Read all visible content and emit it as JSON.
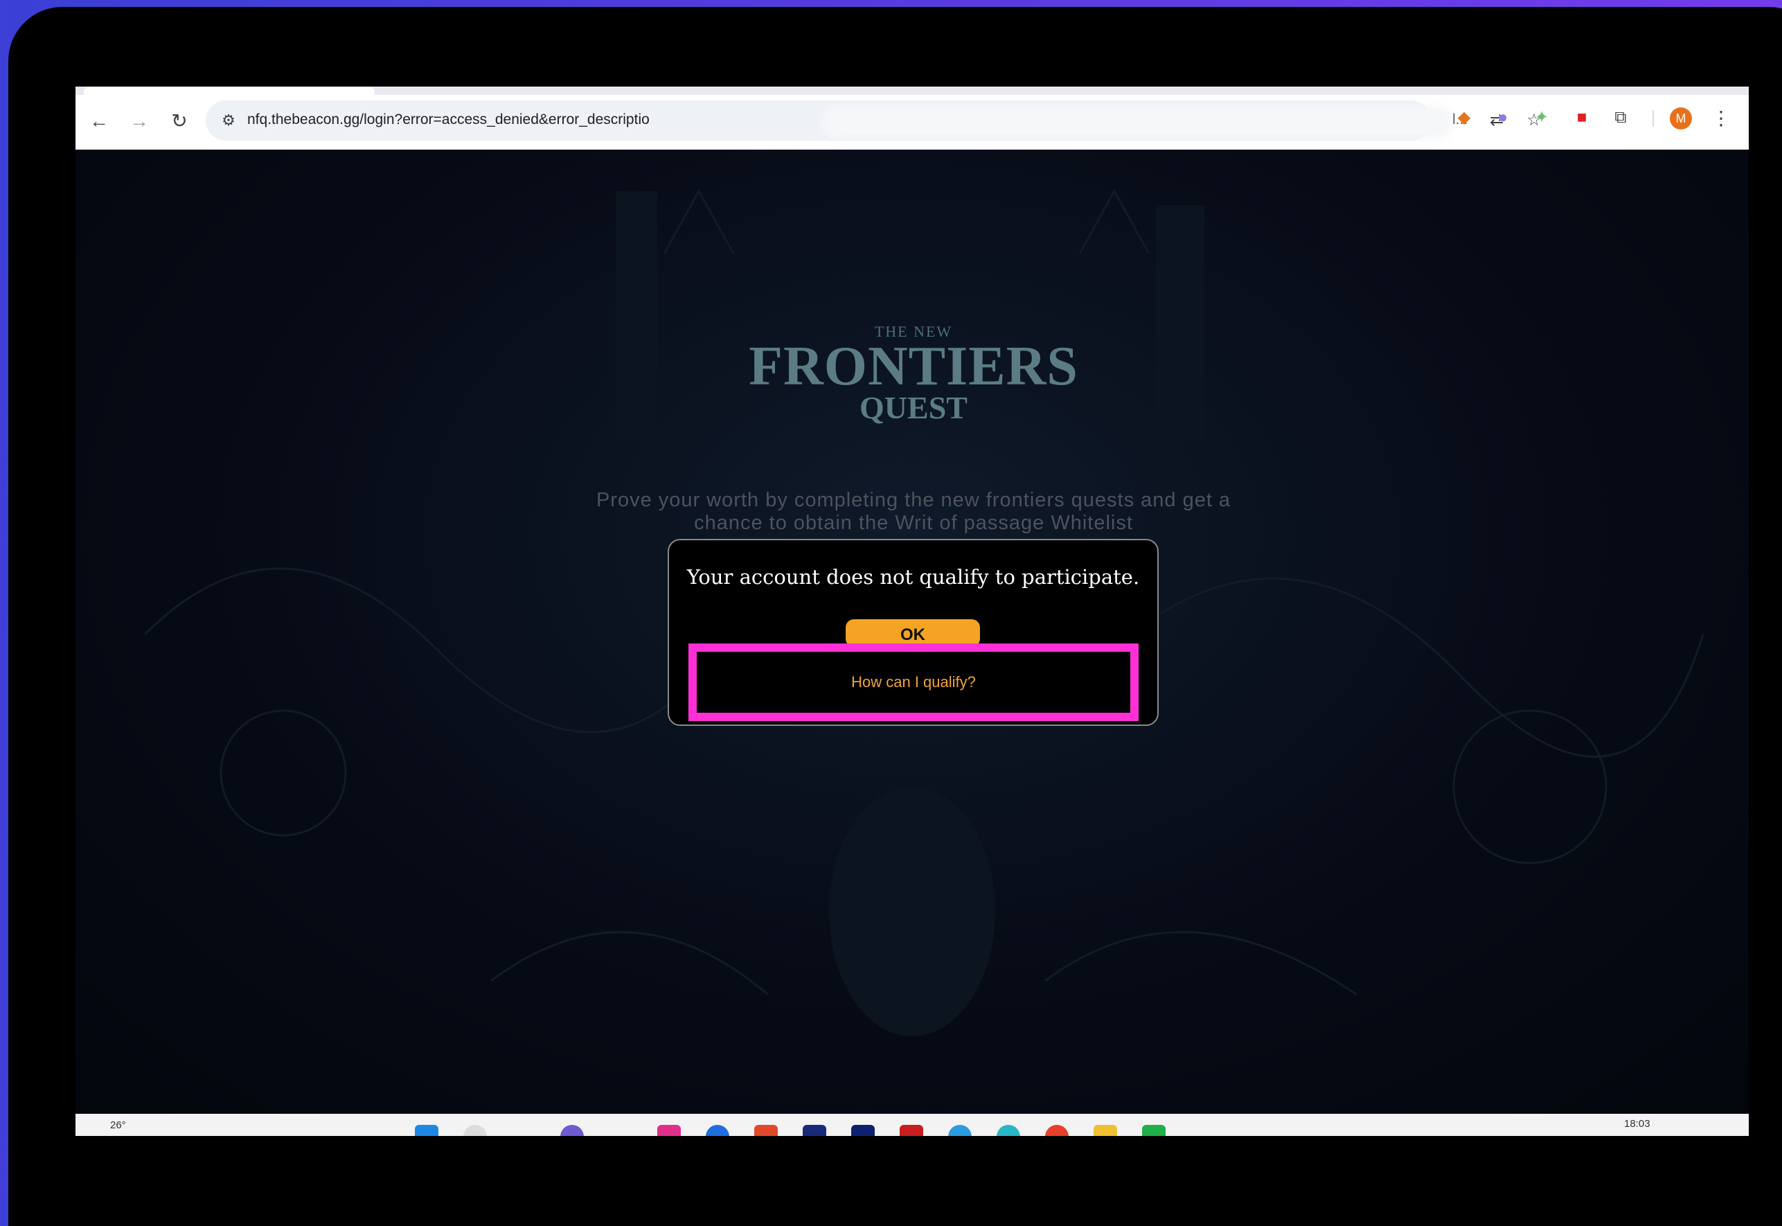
{
  "browser": {
    "url": "nfq.thebeacon.gg/login?error=access_denied&error_descriptio",
    "url_trailing": "l...",
    "profile_initial": "M"
  },
  "page": {
    "logo_small": "THE NEW",
    "logo_main": "FRONTIERS",
    "logo_sub": "QUEST",
    "subtitle_line1": "Prove your worth by completing the new frontiers quests and get a",
    "subtitle_line2": "chance to obtain the Writ of passage Whitelist"
  },
  "dialog": {
    "message": "Your account does not qualify to participate.",
    "ok_label": "OK",
    "qualify_label": "How can I qualify?"
  },
  "taskbar": {
    "temperature": "26°",
    "time": "18:03"
  },
  "colors": {
    "highlight": "#ff31d6",
    "ok_button": "#f4a422",
    "qualify_text": "#f0a33a"
  }
}
